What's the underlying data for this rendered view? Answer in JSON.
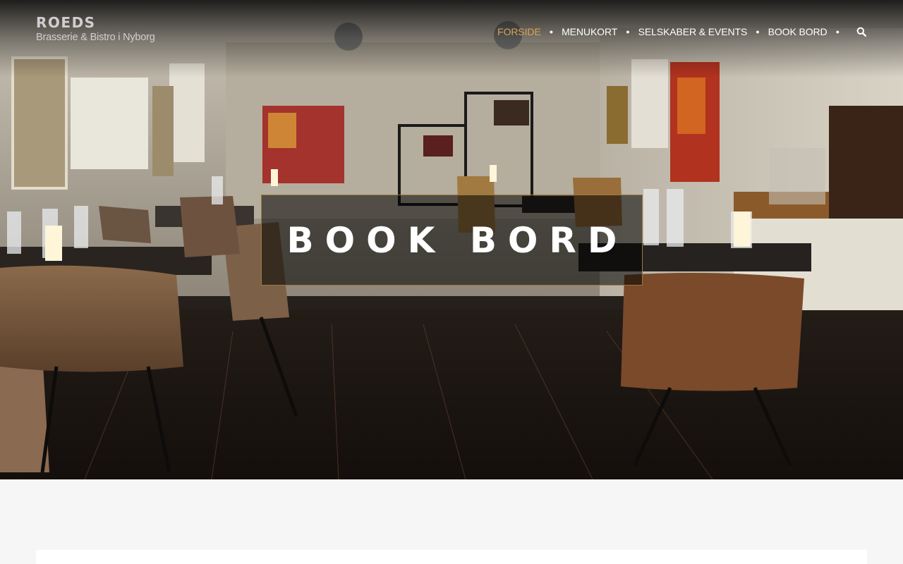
{
  "logo": {
    "brand": "ROEDS",
    "tagline": "Brasserie & Bistro i Nyborg"
  },
  "nav": {
    "items": [
      {
        "label": "FORSIDE",
        "active": true
      },
      {
        "label": "MENUKORT",
        "active": false
      },
      {
        "label": "SELSKABER & EVENTS",
        "active": false
      },
      {
        "label": "BOOK BORD",
        "active": false
      }
    ],
    "search_icon": "search-icon"
  },
  "hero": {
    "title": "BOOK BORD",
    "image": "restaurant-interior-photo"
  },
  "colors": {
    "accent": "#d9a355",
    "title_border": "#9a7a3a",
    "page_background": "#f6f6f6"
  }
}
